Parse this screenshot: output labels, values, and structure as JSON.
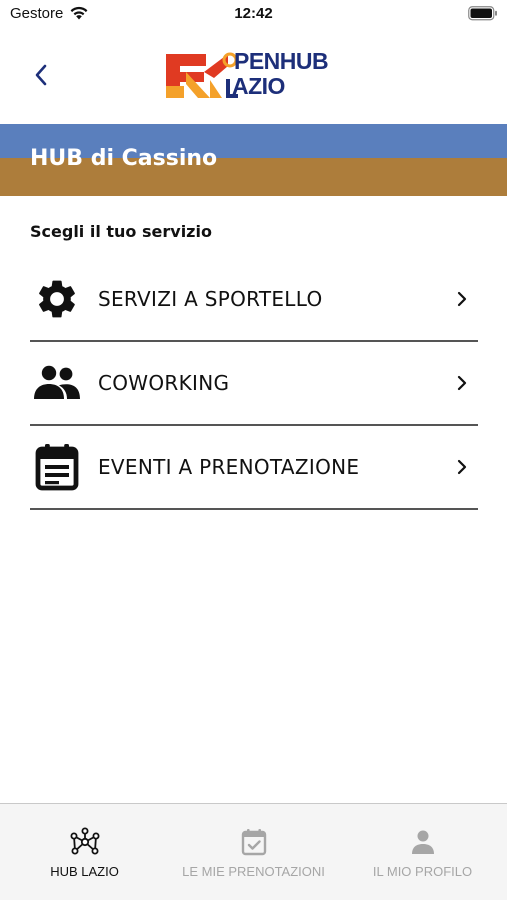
{
  "status_bar": {
    "carrier": "Gestore",
    "time": "12:42"
  },
  "header": {
    "logo_line1": "PENHUB",
    "logo_line2": "AZIO"
  },
  "banner": {
    "title": "HUB di Cassino",
    "color_top": "#5a7fbd",
    "color_bottom": "#ad7d3b"
  },
  "main": {
    "section_label": "Scegli il tuo servizio",
    "services": [
      {
        "label": "SERVIZI A SPORTELLO",
        "icon": "gear-icon"
      },
      {
        "label": "COWORKING",
        "icon": "people-icon"
      },
      {
        "label": "EVENTI A PRENOTAZIONE",
        "icon": "calendar-icon"
      }
    ]
  },
  "tab_bar": {
    "tabs": [
      {
        "label": "HUB LAZIO",
        "icon": "network-icon",
        "active": true
      },
      {
        "label": "LE MIE PRENOTAZIONI",
        "icon": "calendar-check-icon",
        "active": false
      },
      {
        "label": "IL MIO PROFILO",
        "icon": "user-icon",
        "active": false
      }
    ]
  }
}
